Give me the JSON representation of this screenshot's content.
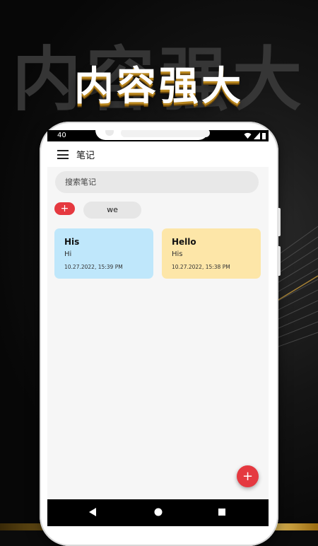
{
  "banner": {
    "shadow_text": "内容强大",
    "title": "内容强大"
  },
  "status_bar": {
    "time": "40",
    "icons": [
      "wifi-icon",
      "signal-icon",
      "battery-icon"
    ]
  },
  "app_bar": {
    "menu_icon": "hamburger-menu-icon",
    "title": "笔记"
  },
  "search": {
    "placeholder": "搜索笔记"
  },
  "tags": {
    "add_label": "+",
    "items": [
      {
        "label": "we"
      }
    ]
  },
  "notes": [
    {
      "title": "His",
      "body": "Hi",
      "date": "10.27.2022, 15:39 PM",
      "color": "#bfe7fb"
    },
    {
      "title": "Hello",
      "body": "His",
      "date": "10.27.2022, 15:38 PM",
      "color": "#fde6a8"
    }
  ],
  "fab": {
    "label": "+",
    "color": "#e53940"
  },
  "nav_bar": {
    "buttons": [
      "back-icon",
      "home-icon",
      "recents-icon"
    ]
  },
  "colors": {
    "accent": "#e53940",
    "gold": "#e8b63a"
  }
}
